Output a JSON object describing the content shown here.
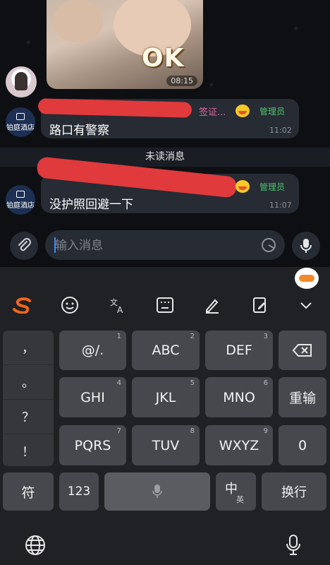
{
  "chat": {
    "photo": {
      "overlay_text": "OK",
      "time": "08:15"
    },
    "messages": [
      {
        "sender": "签证...",
        "role": "管理员",
        "text": "路口有警察",
        "time": "11:02",
        "avatar_text": "铂庭酒店"
      },
      {
        "sender": "",
        "role": "管理员",
        "text": "没护照回避一下",
        "time": "11:07",
        "avatar_text": "铂庭酒店"
      }
    ],
    "unread_divider": "未读消息"
  },
  "composer": {
    "placeholder": "输入消息"
  },
  "keyboard": {
    "toolbar": [
      "sogou-logo-icon",
      "emoji-icon",
      "translate-icon",
      "keyboard-layout-icon",
      "handwriting-icon",
      "edit-icon",
      "collapse-icon"
    ],
    "symbols": [
      "，",
      "。",
      "？",
      "！"
    ],
    "rows": [
      [
        {
          "label": "@/.",
          "num": "1"
        },
        {
          "label": "ABC",
          "num": "2"
        },
        {
          "label": "DEF",
          "num": "3"
        }
      ],
      [
        {
          "label": "GHI",
          "num": "4"
        },
        {
          "label": "JKL",
          "num": "5"
        },
        {
          "label": "MNO",
          "num": "6"
        }
      ],
      [
        {
          "label": "PQRS",
          "num": "7"
        },
        {
          "label": "TUV",
          "num": "8"
        },
        {
          "label": "WXYZ",
          "num": "9"
        }
      ]
    ],
    "reenter": "重输",
    "zero": "0",
    "fu": "符",
    "num123": "123",
    "lang_main": "中",
    "lang_sub": "英",
    "newline": "换行"
  }
}
